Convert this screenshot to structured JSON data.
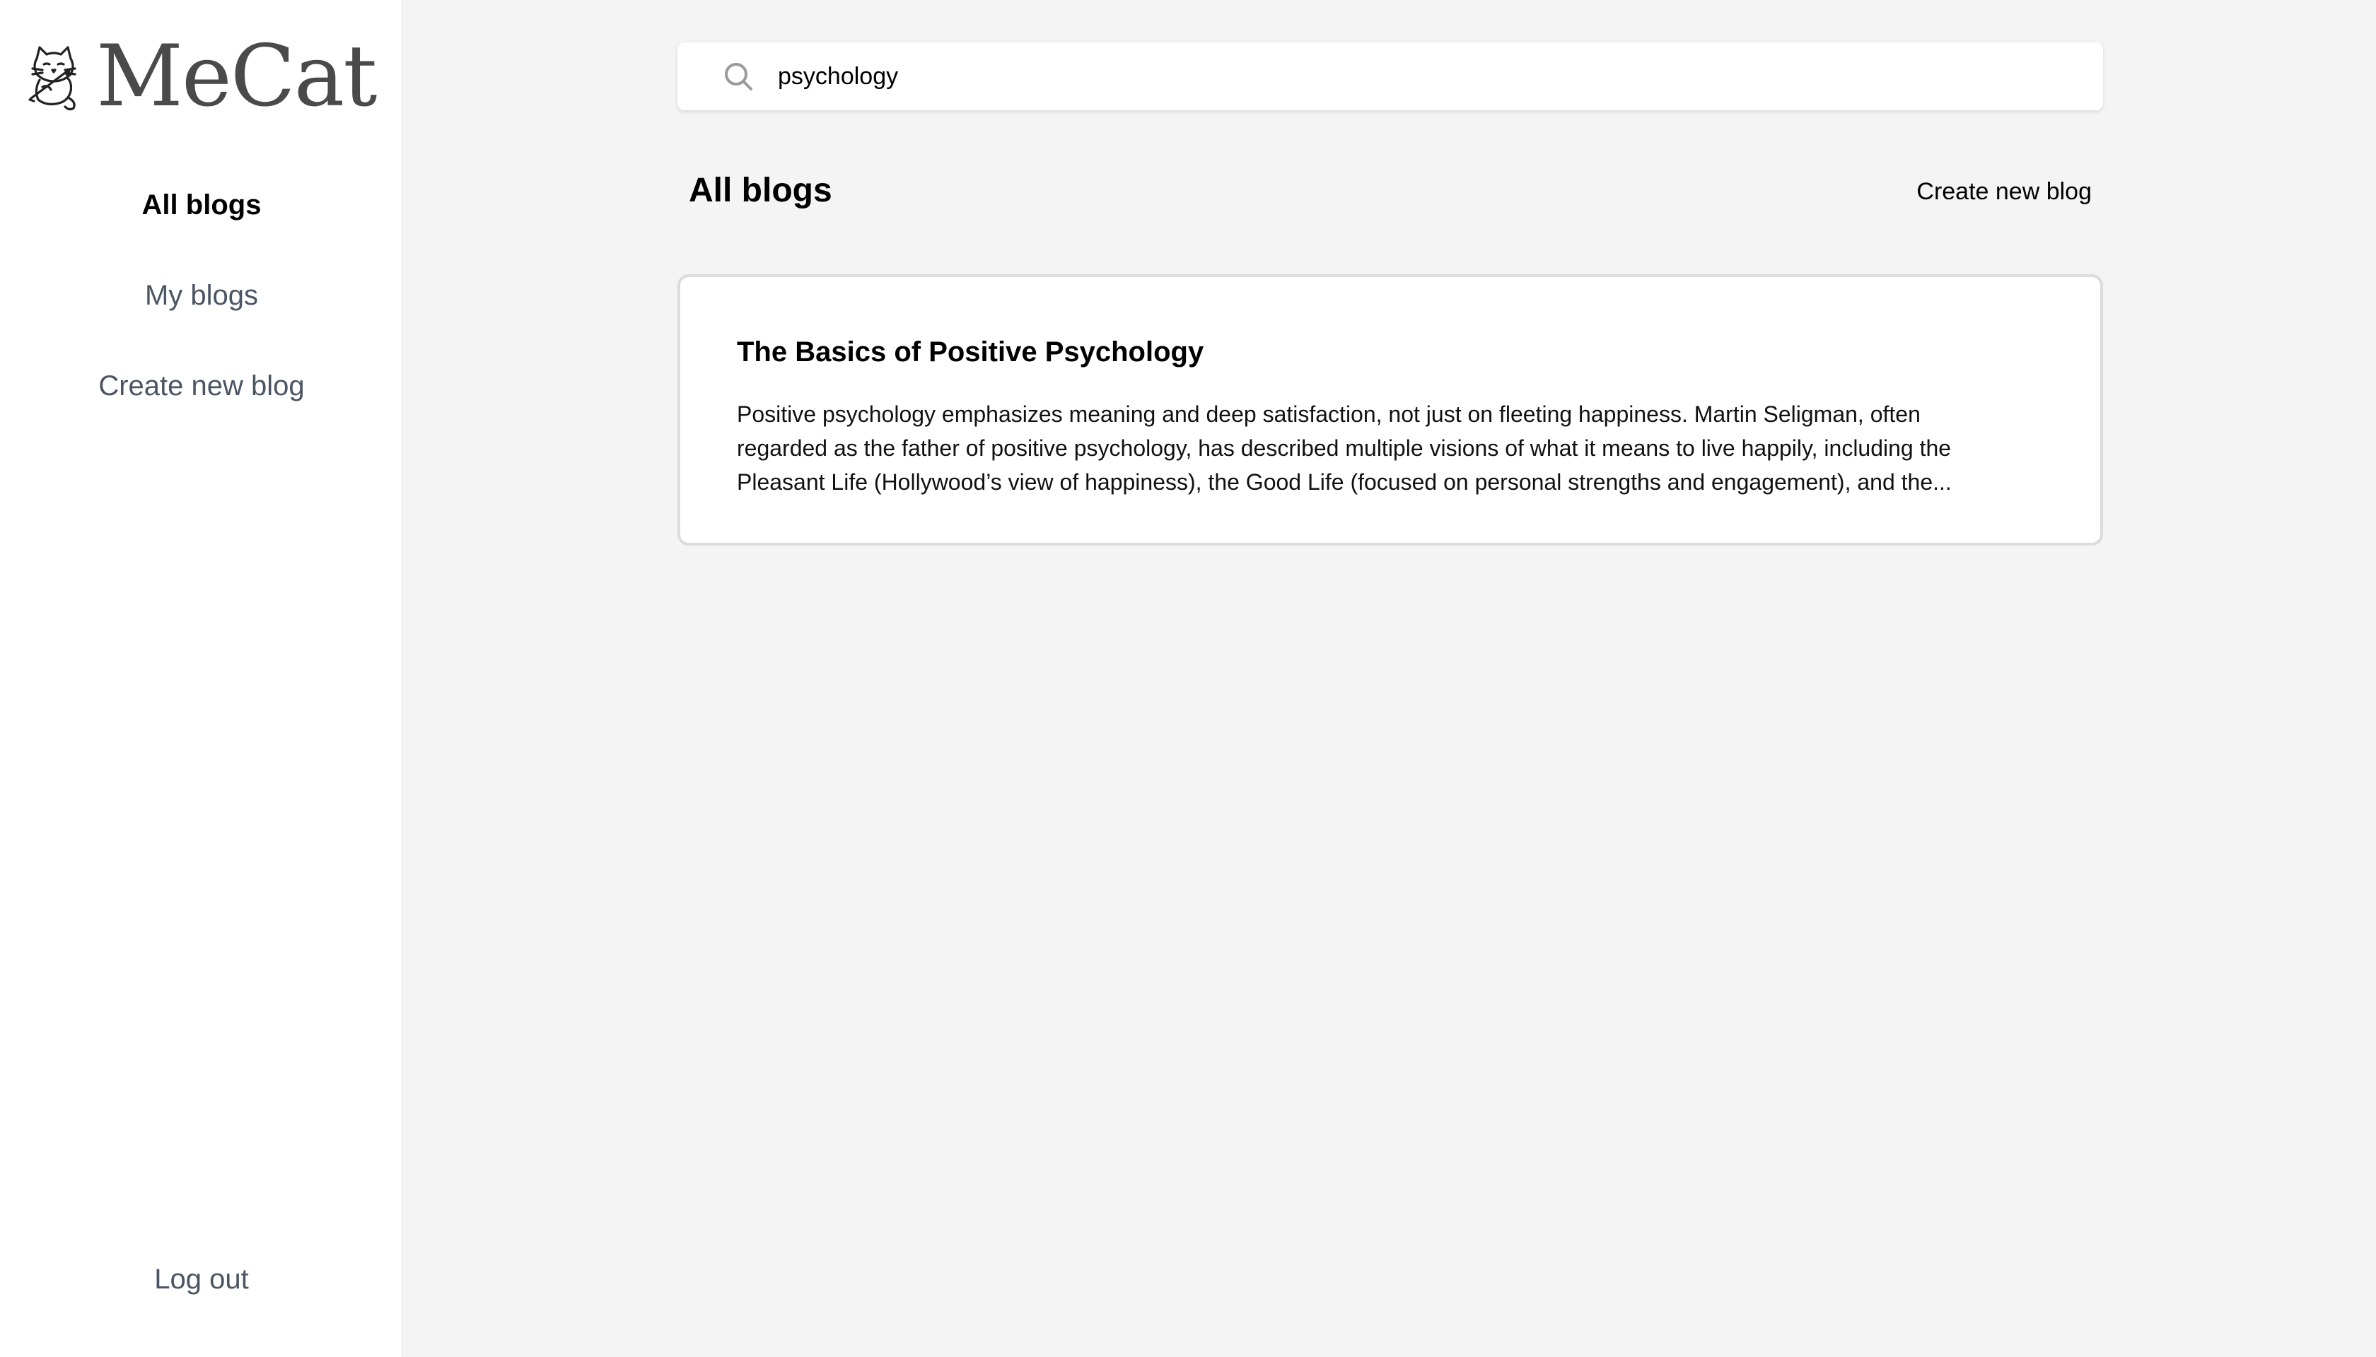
{
  "brand": {
    "name": "MeCat",
    "logo_icon": "cat-writing-logo-icon"
  },
  "sidebar": {
    "items": [
      {
        "label": "All blogs",
        "active": true
      },
      {
        "label": "My blogs",
        "active": false
      },
      {
        "label": "Create new blog",
        "active": false
      }
    ],
    "logout_label": "Log out"
  },
  "search": {
    "value": "psychology",
    "icon": "search-icon"
  },
  "main": {
    "title": "All blogs",
    "create_label": "Create new blog",
    "blogs": [
      {
        "title": "The Basics of Positive Psychology",
        "excerpt": "Positive psychology emphasizes meaning and deep satisfaction, not just on fleeting happiness. Martin Seligman, often regarded as the father of positive psychology, has described multiple visions of what it means to live happily, including the Pleasant Life (Hollywood’s view of happiness), the Good Life (focused on personal strengths and engagement), and the..."
      }
    ]
  },
  "colors": {
    "background": "#f4f4f4",
    "sidebar": "#ffffff",
    "nav_inactive": "#4b5563",
    "brand_text": "#4a4a4a",
    "card_border": "#dcdcdc"
  }
}
